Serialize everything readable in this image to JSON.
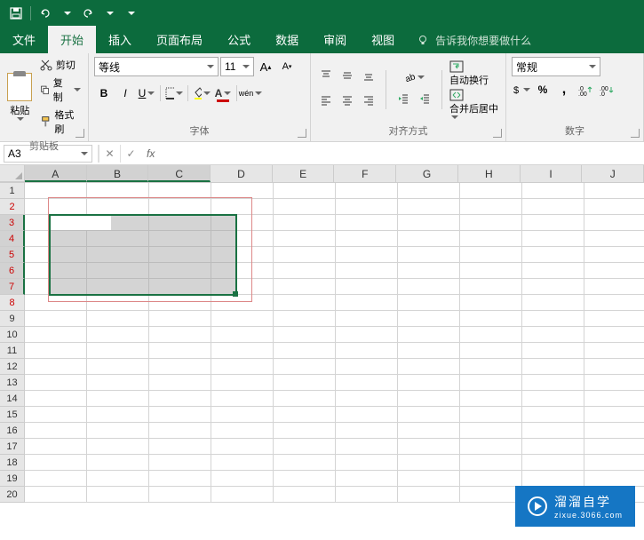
{
  "title_bar": {
    "save_icon": "save",
    "undo_icon": "undo",
    "redo_icon": "redo"
  },
  "tabs": {
    "file": "文件",
    "home": "开始",
    "insert": "插入",
    "layout": "页面布局",
    "formula": "公式",
    "data": "数据",
    "review": "审阅",
    "view": "视图",
    "tell_me": "告诉我你想要做什么"
  },
  "ribbon": {
    "clipboard": {
      "paste": "粘贴",
      "cut": "剪切",
      "copy": "复制",
      "format_painter": "格式刷",
      "label": "剪贴板"
    },
    "font": {
      "name": "等线",
      "size": "11",
      "bold": "B",
      "italic": "I",
      "underline": "U",
      "phonetic": "wén",
      "label": "字体"
    },
    "alignment": {
      "wrap": "自动换行",
      "merge": "合并后居中",
      "label": "对齐方式"
    },
    "number": {
      "format": "常规",
      "percent": "%",
      "comma": ",",
      "label": "数字"
    }
  },
  "formula_bar": {
    "name_box": "A3",
    "fx": "fx"
  },
  "grid": {
    "columns": [
      "A",
      "B",
      "C",
      "D",
      "E",
      "F",
      "G",
      "H",
      "I",
      "J"
    ],
    "rows": [
      "1",
      "2",
      "3",
      "4",
      "5",
      "6",
      "7",
      "8",
      "9",
      "10",
      "11",
      "12",
      "13",
      "14",
      "15",
      "16",
      "17",
      "18",
      "19",
      "20"
    ],
    "selected_columns": [
      "A",
      "B",
      "C"
    ],
    "selected_rows": [
      "3",
      "4",
      "5",
      "6",
      "7"
    ],
    "red_rows": [
      "2",
      "3",
      "4",
      "5",
      "6",
      "7",
      "8"
    ],
    "active_cell": "A3",
    "selection": "A3:C7"
  },
  "watermark": {
    "text": "溜溜自学",
    "sub": "zixue.3066.com"
  }
}
